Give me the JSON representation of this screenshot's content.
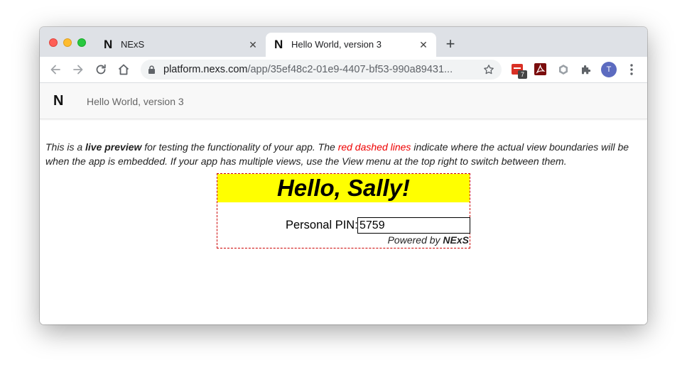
{
  "tabs": [
    {
      "title": "NExS",
      "icon": "nexs-logo-icon"
    },
    {
      "title": "Hello World, version 3",
      "icon": "nexs-logo-icon",
      "active": true
    }
  ],
  "toolbar": {
    "url_host": "platform.nexs.com",
    "url_path": "/app/35ef48c2-01e9-4407-bf53-990a89431...",
    "extension_badge": "7",
    "profile_initial": "T"
  },
  "app": {
    "logo": "N",
    "title": "Hello World, version 3",
    "notice": {
      "part1": "This is a ",
      "bold": "live preview",
      "part2": " for testing the functionality of your app. The ",
      "red": "red dashed lines",
      "part3": " indicate where the actual view boundaries will be when the app is embedded. If your app has multiple views, use the View menu at the top right to switch between them."
    },
    "preview": {
      "greeting": "Hello, Sally!",
      "pin_label": "Personal PIN:",
      "pin_value": "5759",
      "powered_prefix": "Powered by ",
      "powered_brand": "NExS"
    }
  },
  "colors": {
    "banner": "#ffff00",
    "boundary": "#cc0000",
    "notice_highlight": "#ee0000"
  }
}
